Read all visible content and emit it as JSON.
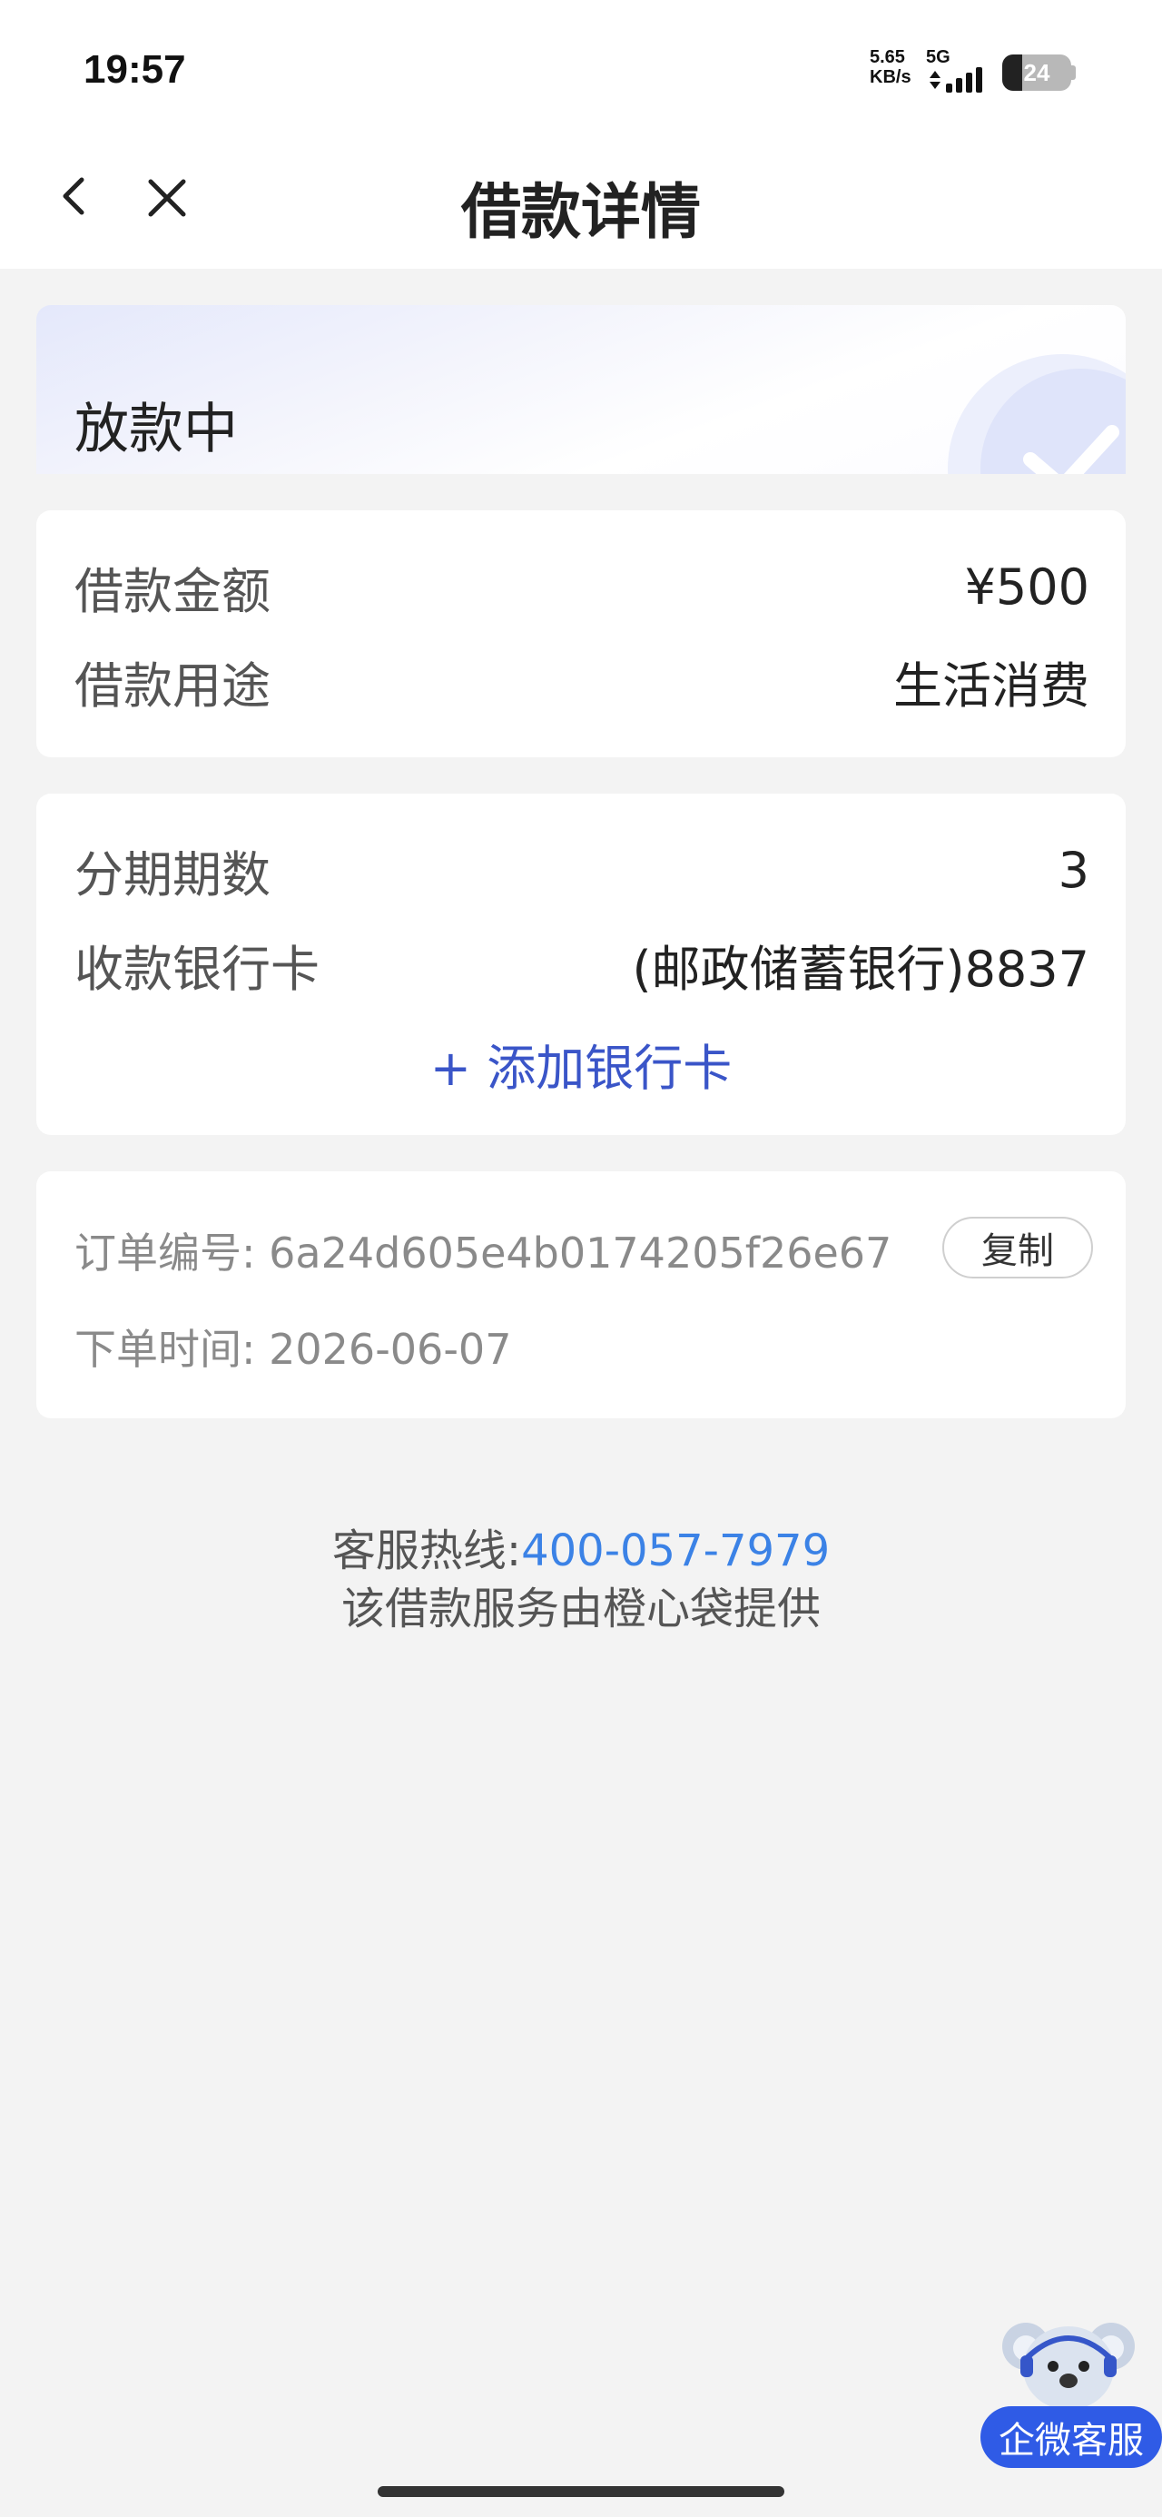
{
  "status_bar": {
    "time": "19:57",
    "net_speed_value": "5.65",
    "net_speed_unit": "KB/s",
    "network_type": "5G",
    "battery_level": "24"
  },
  "header": {
    "title": "借款详情",
    "back_icon": "chevron-left-icon",
    "close_icon": "close-icon"
  },
  "loan_status": {
    "text": "放款中",
    "icon": "check-circle-icon"
  },
  "loan_info": {
    "amount_label": "借款金额",
    "amount_value": "¥500",
    "purpose_label": "借款用途",
    "purpose_value": "生活消费"
  },
  "installment_info": {
    "periods_label": "分期期数",
    "periods_value": "3",
    "bank_label": "收款银行卡",
    "bank_value": "(邮政储蓄银行)8837",
    "add_card_label": "+ 添加银行卡"
  },
  "order_info": {
    "order_no_label": "订单编号:",
    "order_no_value": "6a24d605e4b0174205f26e67",
    "copy_label": "复制",
    "order_time_label": "下单时间:",
    "order_time_value": "2026-06-07"
  },
  "footer": {
    "hotline_label": "客服热线:",
    "hotline_number": "400-057-7979",
    "provider_text": "该借款服务由橙心袋提供"
  },
  "floating_service": {
    "label": "企微客服",
    "icon": "koala-mascot-icon"
  },
  "colors": {
    "accent_blue": "#3a55c8",
    "link_blue": "#3b82e6",
    "service_blue": "#2f5be6",
    "background": "#f3f3f3"
  }
}
